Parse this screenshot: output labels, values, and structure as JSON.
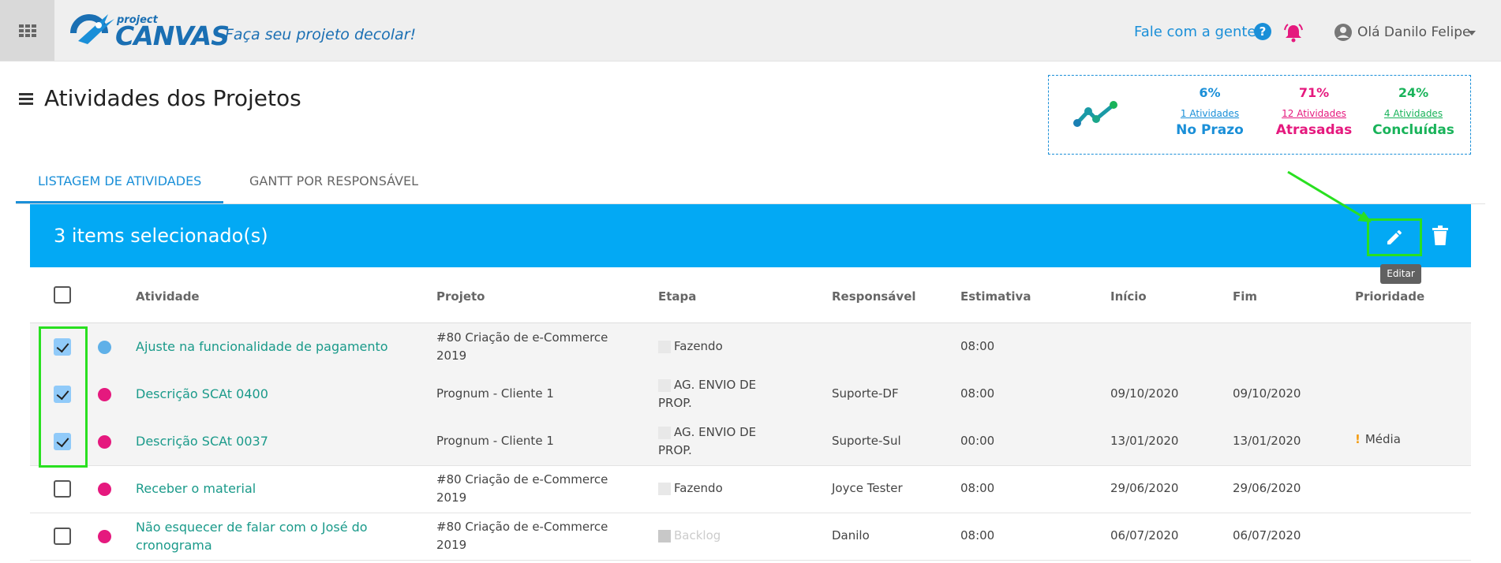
{
  "header": {
    "logo_small": "project",
    "logo_big": "CANVAS",
    "tagline": "Faça seu projeto decolar!",
    "contact_label": "Fale com a gente",
    "help_glyph": "?",
    "user_name": "Olá Danilo Felipe"
  },
  "page": {
    "title": "Atividades dos Projetos"
  },
  "stats": {
    "on_time": {
      "pct": "6%",
      "count": "1 Atividades",
      "label": "No Prazo",
      "color": "#1a8fd8"
    },
    "late": {
      "pct": "71%",
      "count": "12 Atividades",
      "label": "Atrasadas",
      "color": "#e5197e"
    },
    "done": {
      "pct": "24%",
      "count": "4 Atividades",
      "label": "Concluídas",
      "color": "#19b35a"
    }
  },
  "tabs": [
    {
      "label": "LISTAGEM DE ATIVIDADES",
      "active": true
    },
    {
      "label": "GANTT POR RESPONSÁVEL",
      "active": false
    }
  ],
  "selection_bar": {
    "text": "3 items selecionado(s)",
    "tooltip": "Editar"
  },
  "columns": [
    "Atividade",
    "Projeto",
    "Etapa",
    "Responsável",
    "Estimativa",
    "Início",
    "Fim",
    "Prioridade"
  ],
  "rows": [
    {
      "checked": true,
      "dot_color": "#5fb0e8",
      "activity": "Ajuste na funcionalidade de pagamento",
      "project": "#80 Criação de e-Commerce 2019",
      "stage": "Fazendo",
      "owner": "",
      "estimate": "08:00",
      "start": "",
      "end": "",
      "priority": ""
    },
    {
      "checked": true,
      "dot_color": "#e5197e",
      "activity": "Descrição SCAt 0400",
      "project": "Prognum - Cliente 1",
      "stage": "AG. ENVIO DE PROP.",
      "owner": "Suporte-DF",
      "estimate": "08:00",
      "start": "09/10/2020",
      "end": "09/10/2020",
      "priority": ""
    },
    {
      "checked": true,
      "dot_color": "#e5197e",
      "activity": "Descrição SCAt 0037",
      "project": "Prognum - Cliente 1",
      "stage": "AG. ENVIO DE PROP.",
      "owner": "Suporte-Sul",
      "estimate": "00:00",
      "start": "13/01/2020",
      "end": "13/01/2020",
      "priority": "Média"
    },
    {
      "checked": false,
      "dot_color": "#e5197e",
      "activity": "Receber o material",
      "project": "#80 Criação de e-Commerce 2019",
      "stage": "Fazendo",
      "owner": "Joyce Tester",
      "estimate": "08:00",
      "start": "29/06/2020",
      "end": "29/06/2020",
      "priority": ""
    },
    {
      "checked": false,
      "dot_color": "#e5197e",
      "activity": "Não esquecer de falar com o José do cronograma",
      "project": "#80 Criação de e-Commerce 2019",
      "stage": "Backlog",
      "owner": "Danilo",
      "estimate": "08:00",
      "start": "06/07/2020",
      "end": "06/07/2020",
      "priority": ""
    }
  ]
}
